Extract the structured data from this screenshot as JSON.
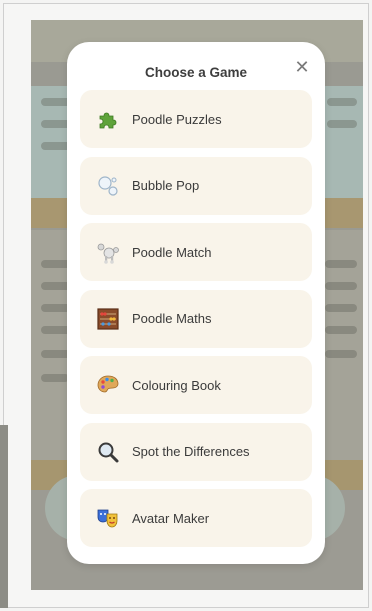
{
  "modal": {
    "title": "Choose a Game",
    "close_symbol": "✕"
  },
  "games": [
    {
      "label": "Poodle Puzzles",
      "icon": "puzzle-piece-icon"
    },
    {
      "label": "Bubble Pop",
      "icon": "bubbles-icon"
    },
    {
      "label": "Poodle Match",
      "icon": "poodle-icon"
    },
    {
      "label": "Poodle Maths",
      "icon": "abacus-icon"
    },
    {
      "label": "Colouring Book",
      "icon": "palette-icon"
    },
    {
      "label": "Spot the Differences",
      "icon": "magnifying-glass-icon"
    },
    {
      "label": "Avatar Maker",
      "icon": "theater-masks-icon"
    }
  ],
  "colors": {
    "item_bg": "#f9f4ea",
    "modal_bg": "#ffffff",
    "title": "#3e3e3e"
  }
}
